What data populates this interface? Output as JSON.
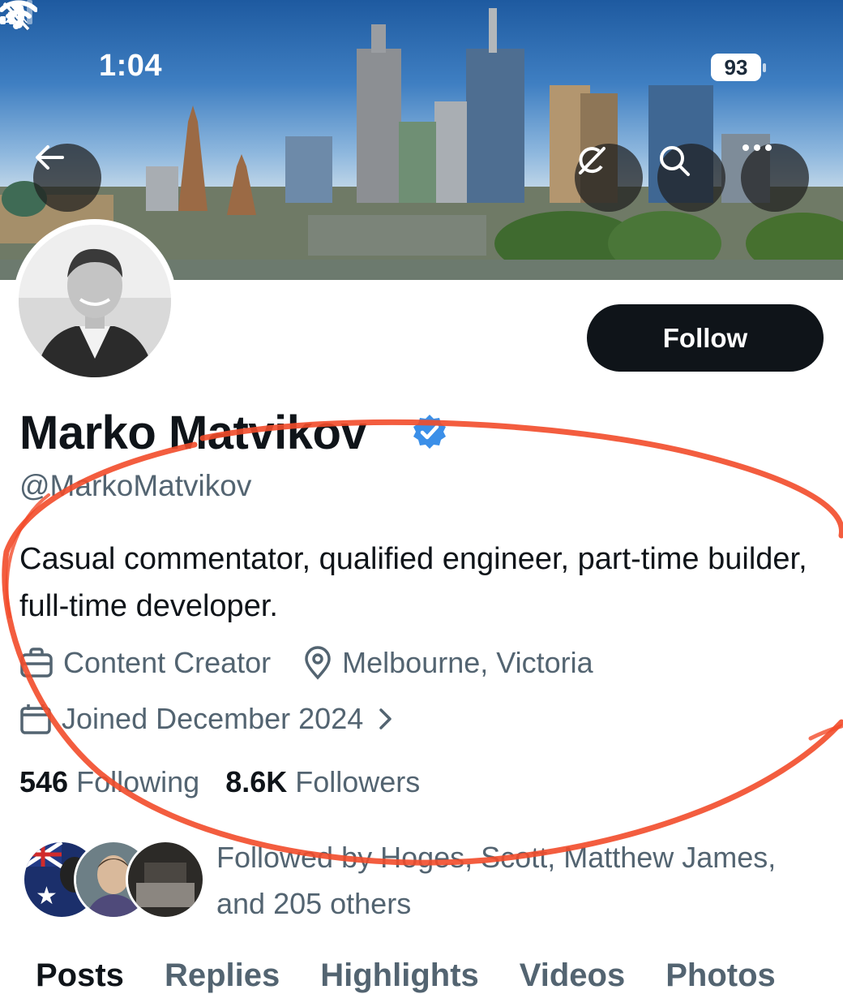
{
  "status_bar": {
    "time": "1:04",
    "battery": "93"
  },
  "profile": {
    "name": "Marko Matvikov",
    "handle": "@MarkoMatvikov",
    "bio": "Casual commentator, qualified engineer, part-time builder, full-time developer.",
    "category": "Content Creator",
    "location": "Melbourne, Victoria",
    "joined": "Joined December 2024",
    "following_count": "546",
    "following_label": "Following",
    "followers_count": "8.6K",
    "followers_label": "Followers",
    "followed_by": "Followed by Hoges, Scott, Matthew James, and 205 others"
  },
  "actions": {
    "follow_label": "Follow"
  },
  "tabs": [
    {
      "label": "Posts"
    },
    {
      "label": "Replies"
    },
    {
      "label": "Highlights"
    },
    {
      "label": "Videos"
    },
    {
      "label": "Photos"
    }
  ],
  "icons": {
    "back": "back-arrow-icon",
    "grok": "grok-icon",
    "search": "search-icon",
    "more": "more-icon",
    "verified": "verified-badge-icon",
    "category": "briefcase-icon",
    "location": "location-pin-icon",
    "joined": "calendar-icon",
    "chevron": "chevron-right-icon"
  },
  "colors": {
    "accent": "#0f1419",
    "secondary_text": "#536471",
    "verified": "#3b8fe8",
    "annotation": "#f24b2a"
  }
}
